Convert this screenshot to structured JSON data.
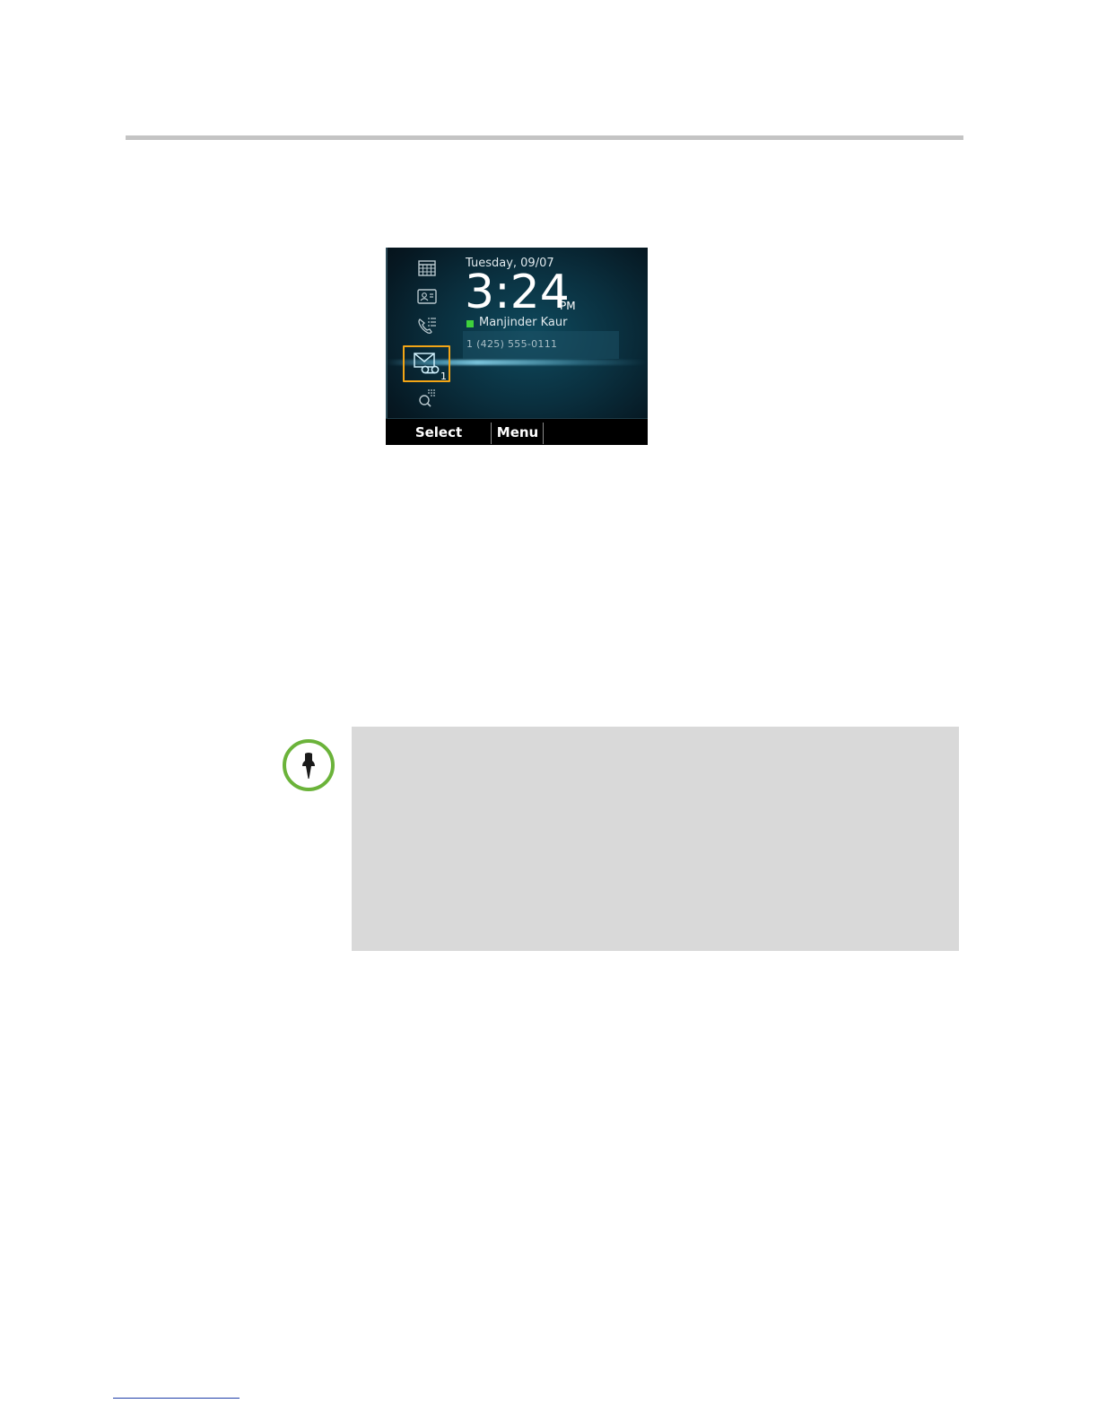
{
  "phone": {
    "date": "Tuesday, 09/07",
    "time": "3:24",
    "ampm": "PM",
    "contact_name": "Manjinder Kaur",
    "line_number": "1 (425) 555-0111",
    "voicemail_count": "1",
    "status_color": "#3fd13c",
    "highlight_color": "#f2a516",
    "rail_icons": [
      "calendar-icon",
      "contact-card-icon",
      "call-log-icon",
      "voicemail-icon",
      "dialpad-search-icon"
    ],
    "softkeys": {
      "select": "Select",
      "menu": "Menu"
    }
  },
  "note": {
    "icon": "pushpin-icon",
    "accent_color": "#6bb33a"
  }
}
